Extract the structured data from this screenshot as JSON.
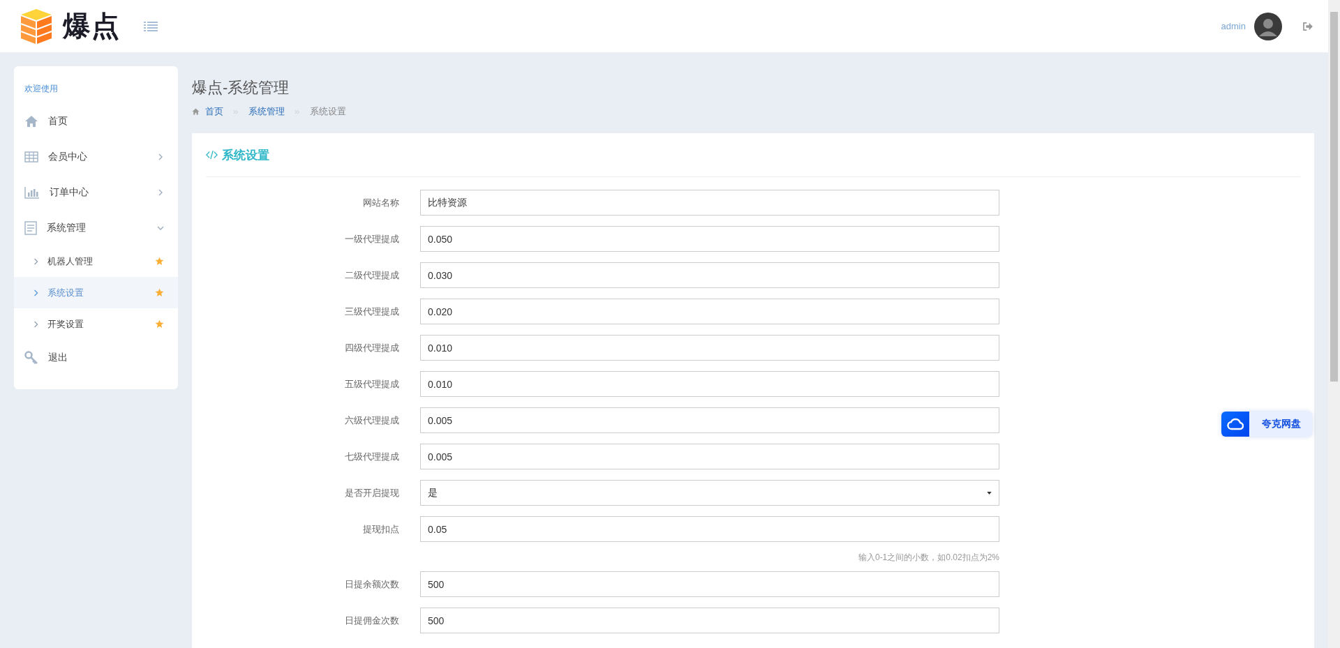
{
  "header": {
    "logo_text": "爆点",
    "user": "admin"
  },
  "sidebar": {
    "heading": "欢迎使用",
    "items": [
      {
        "label": "首页"
      },
      {
        "label": "会员中心",
        "expanded": false
      },
      {
        "label": "订单中心",
        "expanded": false
      },
      {
        "label": "系统管理",
        "expanded": true,
        "children": [
          {
            "label": "机器人管理",
            "selected": false
          },
          {
            "label": "系统设置",
            "selected": true
          },
          {
            "label": "开奖设置",
            "selected": false
          }
        ]
      },
      {
        "label": "退出"
      }
    ]
  },
  "page": {
    "title": "爆点-系统管理",
    "breadcrumb": [
      "首页",
      "系统管理",
      "系统设置"
    ]
  },
  "card": {
    "title": "系统设置",
    "fields": [
      {
        "label": "网站名称",
        "kind": "input",
        "value": "比特资源"
      },
      {
        "label": "一级代理提成",
        "kind": "input",
        "value": "0.050"
      },
      {
        "label": "二级代理提成",
        "kind": "input",
        "value": "0.030"
      },
      {
        "label": "三级代理提成",
        "kind": "input",
        "value": "0.020"
      },
      {
        "label": "四级代理提成",
        "kind": "input",
        "value": "0.010"
      },
      {
        "label": "五级代理提成",
        "kind": "input",
        "value": "0.010"
      },
      {
        "label": "六级代理提成",
        "kind": "input",
        "value": "0.005"
      },
      {
        "label": "七级代理提成",
        "kind": "input",
        "value": "0.005"
      },
      {
        "label": "是否开启提现",
        "kind": "select",
        "value": "是"
      },
      {
        "label": "提现扣点",
        "kind": "input",
        "value": "0.05",
        "help": "输入0-1之间的小数，如0.02扣点为2%"
      },
      {
        "label": "日提余额次数",
        "kind": "input",
        "value": "500"
      },
      {
        "label": "日提佣金次数",
        "kind": "input",
        "value": "500"
      }
    ]
  },
  "floating_button": {
    "label": "夸克网盘"
  }
}
